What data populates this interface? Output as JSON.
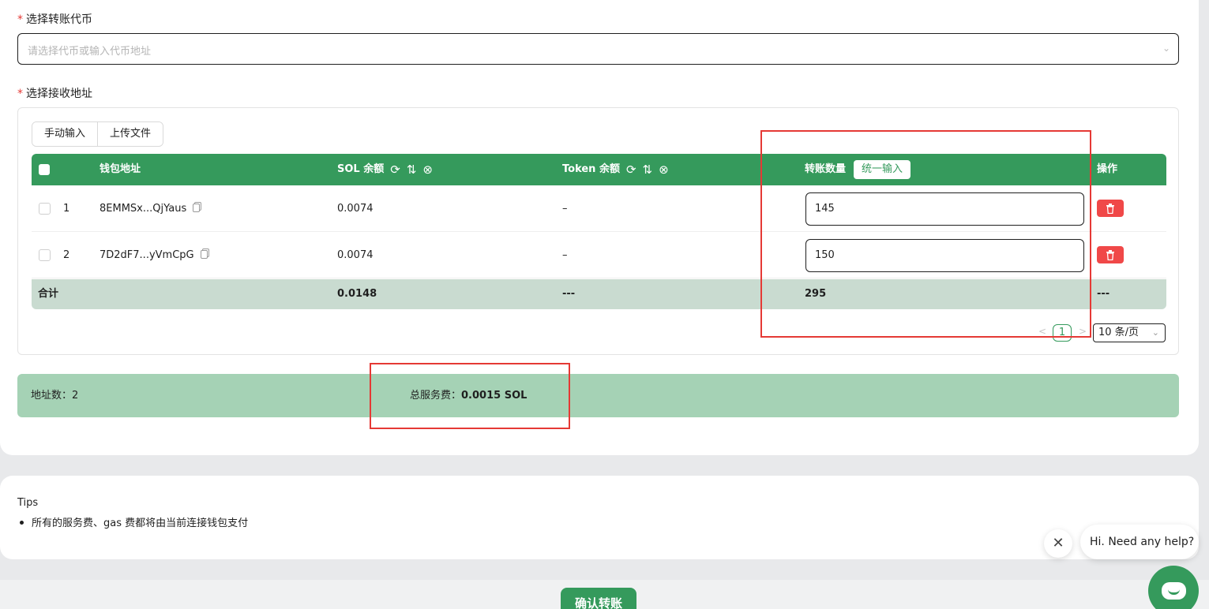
{
  "form": {
    "token_label": "选择转账代币",
    "token_placeholder": "请选择代币或输入代币地址",
    "address_label": "选择接收地址",
    "required_mark": "*"
  },
  "input_modes": [
    "手动输入",
    "上传文件"
  ],
  "table": {
    "headers": {
      "wallet": "钱包地址",
      "sol_balance": "SOL 余额",
      "token_balance": "Token 余额",
      "amount": "转账数量",
      "unified_input": "统一输入",
      "action": "操作"
    },
    "rows": [
      {
        "index": "1",
        "wallet": "8EMMSx...QjYaus",
        "sol": "0.0074",
        "token": "–",
        "amount": "145"
      },
      {
        "index": "2",
        "wallet": "7D2dF7...yVmCpG",
        "sol": "0.0074",
        "token": "–",
        "amount": "150"
      }
    ],
    "footer": {
      "label": "合计",
      "sol": "0.0148",
      "token": "---",
      "amount": "295",
      "action": "---"
    }
  },
  "pagination": {
    "current": "1",
    "page_size": "10 条/页"
  },
  "summary": {
    "address_count": "地址数：2",
    "total_fee_label": "总服务费：",
    "total_fee_value": "0.0015 SOL"
  },
  "tips": {
    "title": "Tips",
    "items": [
      "所有的服务费、gas 费都将由当前连接钱包支付"
    ]
  },
  "confirm_label": "确认转账",
  "chat": {
    "greeting": "Hi. Need any help?"
  },
  "colors": {
    "accent": "#359a5c",
    "danger": "#f04848",
    "summary_bg": "#a5d2b5",
    "highlight": "#e53935"
  }
}
